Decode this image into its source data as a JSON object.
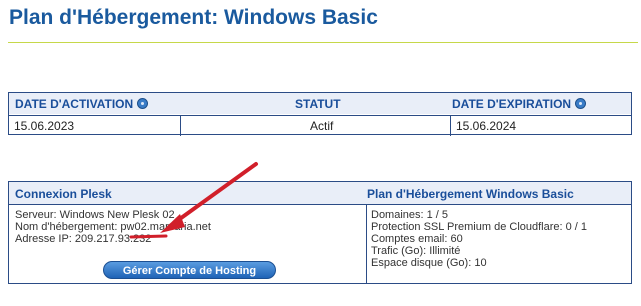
{
  "page": {
    "title": "Plan d'Hébergement: Windows Basic"
  },
  "dates": {
    "headers": {
      "activation": "DATE D'ACTIVATION",
      "status": "STATUT",
      "expiration": "DATE D'EXPIRATION"
    },
    "values": {
      "activation": "15.06.2023",
      "status": "Actif",
      "expiration": "15.06.2024"
    }
  },
  "plesk": {
    "title": "Connexion Plesk",
    "server": "Serveur: Windows New Plesk 02",
    "hostname": "Nom d'hébergement: pw02.marcaria.net",
    "ip": "Adresse IP: 209.217.93.232",
    "button": "Gérer Compte de Hosting"
  },
  "plan": {
    "title": "Plan d'Hébergement Windows Basic",
    "items": [
      "Domaines: 1 / 5",
      "Protection SSL Premium de Cloudflare: 0 / 1",
      "Comptes email: 60",
      "Trafic (Go): Illimité",
      "Espace disque (Go): 10"
    ]
  },
  "colors": {
    "accent": "#1a5a9e",
    "rule": "#c6d84a",
    "border": "#2b4c86",
    "annotation": "#d11f2a"
  },
  "icons": {
    "help": "help-icon",
    "arrow": "annotation-arrow"
  }
}
